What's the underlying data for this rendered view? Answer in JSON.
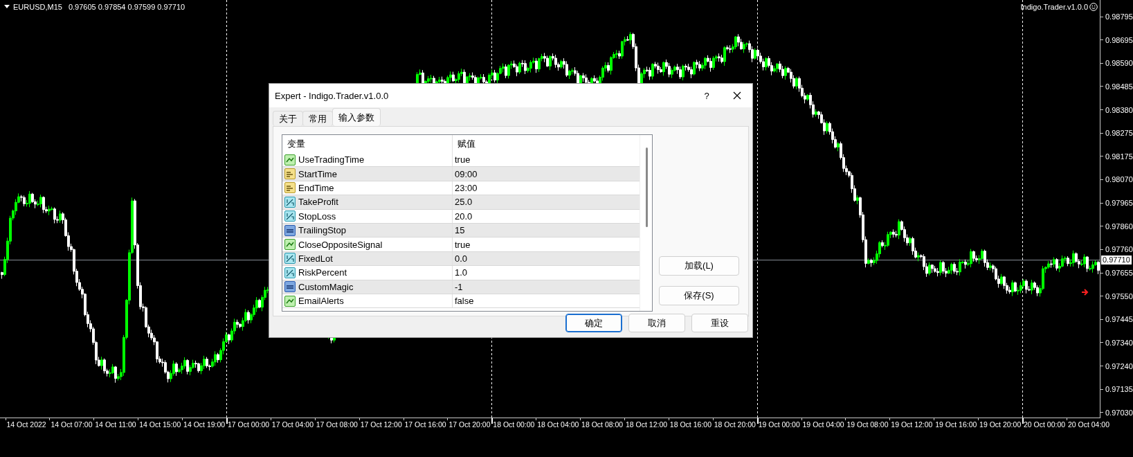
{
  "chart": {
    "symbol": "EURUSD,M15",
    "quotes": "0.97605 0.97854 0.97599 0.97710",
    "expert_label": "Indigo.Trader.v1.0.0",
    "current_price": "0.97710",
    "price_labels": [
      "0.98795",
      "0.98695",
      "0.98590",
      "0.98485",
      "0.98380",
      "0.98275",
      "0.98175",
      "0.98070",
      "0.97965",
      "0.97860",
      "0.97760",
      "0.97655",
      "0.97550",
      "0.97445",
      "0.97340",
      "0.97240",
      "0.97135",
      "0.97030"
    ],
    "time_labels": [
      {
        "label": "14 Oct 2022",
        "day_start": false
      },
      {
        "label": "14 Oct 07:00",
        "day_start": false
      },
      {
        "label": "14 Oct 11:00",
        "day_start": false
      },
      {
        "label": "14 Oct 15:00",
        "day_start": false
      },
      {
        "label": "14 Oct 19:00",
        "day_start": false
      },
      {
        "label": "17 Oct 00:00",
        "day_start": true
      },
      {
        "label": "17 Oct 04:00",
        "day_start": false
      },
      {
        "label": "17 Oct 08:00",
        "day_start": false
      },
      {
        "label": "17 Oct 12:00",
        "day_start": false
      },
      {
        "label": "17 Oct 16:00",
        "day_start": false
      },
      {
        "label": "17 Oct 20:00",
        "day_start": false
      },
      {
        "label": "18 Oct 00:00",
        "day_start": true
      },
      {
        "label": "18 Oct 04:00",
        "day_start": false
      },
      {
        "label": "18 Oct 08:00",
        "day_start": false
      },
      {
        "label": "18 Oct 12:00",
        "day_start": false
      },
      {
        "label": "18 Oct 16:00",
        "day_start": false
      },
      {
        "label": "18 Oct 20:00",
        "day_start": false
      },
      {
        "label": "19 Oct 00:00",
        "day_start": true
      },
      {
        "label": "19 Oct 04:00",
        "day_start": false
      },
      {
        "label": "19 Oct 08:00",
        "day_start": false
      },
      {
        "label": "19 Oct 12:00",
        "day_start": false
      },
      {
        "label": "19 Oct 16:00",
        "day_start": false
      },
      {
        "label": "19 Oct 20:00",
        "day_start": false
      },
      {
        "label": "20 Oct 00:00",
        "day_start": true
      },
      {
        "label": "20 Oct 04:00",
        "day_start": false
      }
    ]
  },
  "dialog": {
    "title": "Expert - Indigo.Trader.v1.0.0",
    "help": "?",
    "tabs": [
      {
        "label": "关于",
        "selected": false
      },
      {
        "label": "常用",
        "selected": false
      },
      {
        "label": "输入参数",
        "selected": true
      }
    ],
    "table": {
      "columns": [
        "变量",
        "赋值"
      ],
      "rows": [
        {
          "kind": "bool",
          "name": "UseTradingTime",
          "value": "true"
        },
        {
          "kind": "string",
          "name": "StartTime",
          "value": "09:00"
        },
        {
          "kind": "string",
          "name": "EndTime",
          "value": "23:00"
        },
        {
          "kind": "double",
          "name": "TakeProfit",
          "value": "25.0"
        },
        {
          "kind": "double",
          "name": "StopLoss",
          "value": "20.0"
        },
        {
          "kind": "int",
          "name": "TrailingStop",
          "value": "15"
        },
        {
          "kind": "bool",
          "name": "CloseOppositeSignal",
          "value": "true"
        },
        {
          "kind": "double",
          "name": "FixedLot",
          "value": "0.0"
        },
        {
          "kind": "double",
          "name": "RiskPercent",
          "value": "1.0"
        },
        {
          "kind": "int",
          "name": "CustomMagic",
          "value": "-1"
        },
        {
          "kind": "bool",
          "name": "EmailAlerts",
          "value": "false"
        }
      ]
    },
    "side_buttons": [
      "加载(L)",
      "保存(S)"
    ],
    "buttons": [
      {
        "label": "确定",
        "default": true
      },
      {
        "label": "取消",
        "default": false
      },
      {
        "label": "重设",
        "default": false
      }
    ]
  }
}
